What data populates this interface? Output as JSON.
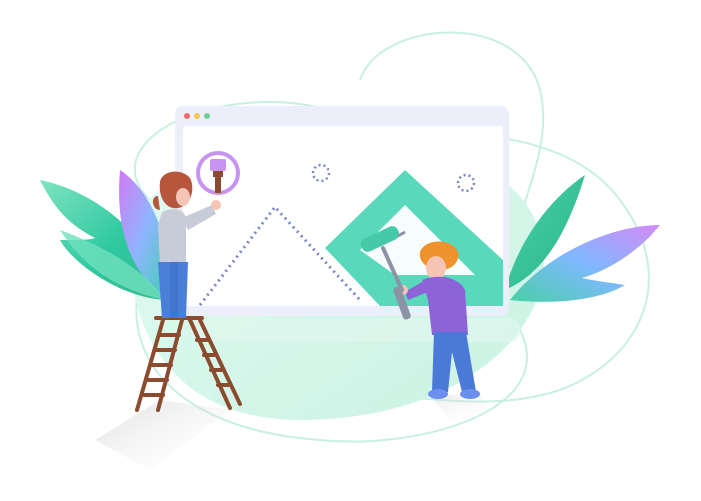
{
  "illustration": {
    "subject": "web-design-illustration",
    "icons": [
      "paintbrush-icon",
      "paint-roller-icon",
      "ladder-icon",
      "image-placeholder-icon"
    ],
    "colors": {
      "mint": "#b9f0de",
      "teal": "#52d8b8",
      "browser_frame": "#eceefa",
      "browser_screen": "#ffffff",
      "dots": [
        "#f26b6b",
        "#f2c94c",
        "#6fcf97"
      ],
      "woman_sweater": "#c7ccd8",
      "woman_skirt": "#4a7fd9",
      "hair": "#b5563d",
      "man_shirt": "#8e63d8",
      "man_pants": "#4b79d8",
      "man_hair": "#f0922b",
      "ladder": "#8a4b2e",
      "leaf_gradient": [
        "#4fd1a5",
        "#7ec3ff",
        "#c36cf5"
      ]
    }
  }
}
